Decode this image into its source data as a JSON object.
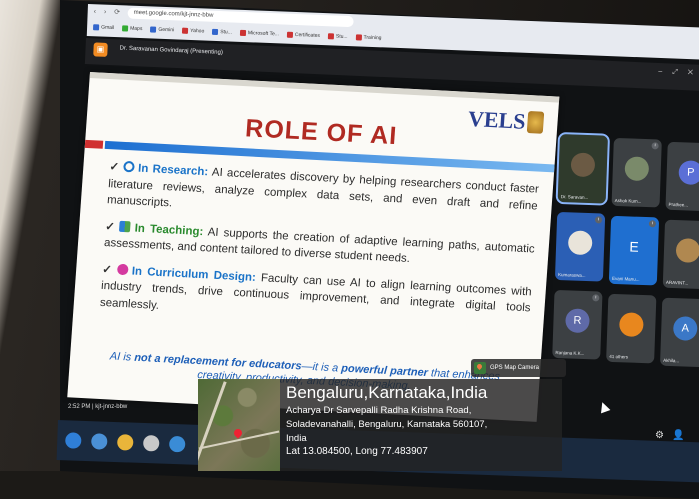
{
  "browser": {
    "url": "meet.google.com/kjt-jnnz-bbw",
    "bookmarks": [
      "Gmail",
      "Maps",
      "Gemini",
      "Yahoo",
      "Stu...",
      "Microsoft Te...",
      "Certificates",
      "Stu...",
      "Training"
    ]
  },
  "meeting": {
    "presenting_label": "Dr. Saravanan Govindaraj (Presenting)",
    "footer_time_code": "2:52 PM | kjt-jnnz-bbw",
    "participants": [
      {
        "name": "Dr. Saravan...",
        "initial": ""
      },
      {
        "name": "Ashok Kum...",
        "initial": ""
      },
      {
        "name": "Prathee...",
        "initial": "P"
      },
      {
        "name": "Kumaraswa...",
        "initial": ""
      },
      {
        "name": "Evani Manu...",
        "initial": "E"
      },
      {
        "name": "ARAVINT...",
        "initial": ""
      },
      {
        "name": "Ranjana K.K...",
        "initial": "R"
      },
      {
        "name": "41 others",
        "initial": ""
      },
      {
        "name": "Akhila...",
        "initial": "A"
      }
    ]
  },
  "slide": {
    "title": "ROLE OF AI",
    "logo": "VELS",
    "items": [
      {
        "heading": "In Research:",
        "text": " AI accelerates discovery by helping researchers conduct faster literature reviews, analyze complex data sets, and even draft and refine manuscripts."
      },
      {
        "heading": "In Teaching:",
        "text": " AI supports the creation of adaptive learning paths, automatic assessments, and content tailored to diverse student needs."
      },
      {
        "heading": "In Curriculum Design:",
        "text": " Faculty can use AI to align learning outcomes with industry trends, drive continuous improvement, and integrate digital tools seamlessly."
      }
    ],
    "footer_line1_a": "AI is ",
    "footer_line1_b": "not a replacement for educators",
    "footer_line1_c": "—it is a ",
    "footer_line1_d": "powerful partner",
    "footer_line1_e": " that enhances",
    "footer_line2": "creativity, productivity, and decision-making."
  },
  "gps_overlay": {
    "app_label": "GPS Map Camera",
    "city": "Bengaluru,Karnataka,India",
    "address_line1": "Acharya Dr Sarvepalli Radha Krishna Road,",
    "address_line2": "Soladevanahalli, Bengaluru, Karnataka 560107,",
    "address_line3": "India",
    "coords": "Lat 13.084500, Long 77.483907"
  },
  "colors": {
    "title_red": "#b02a22",
    "heading_blue": "#1a73c8",
    "heading_green": "#2a8a2e"
  }
}
